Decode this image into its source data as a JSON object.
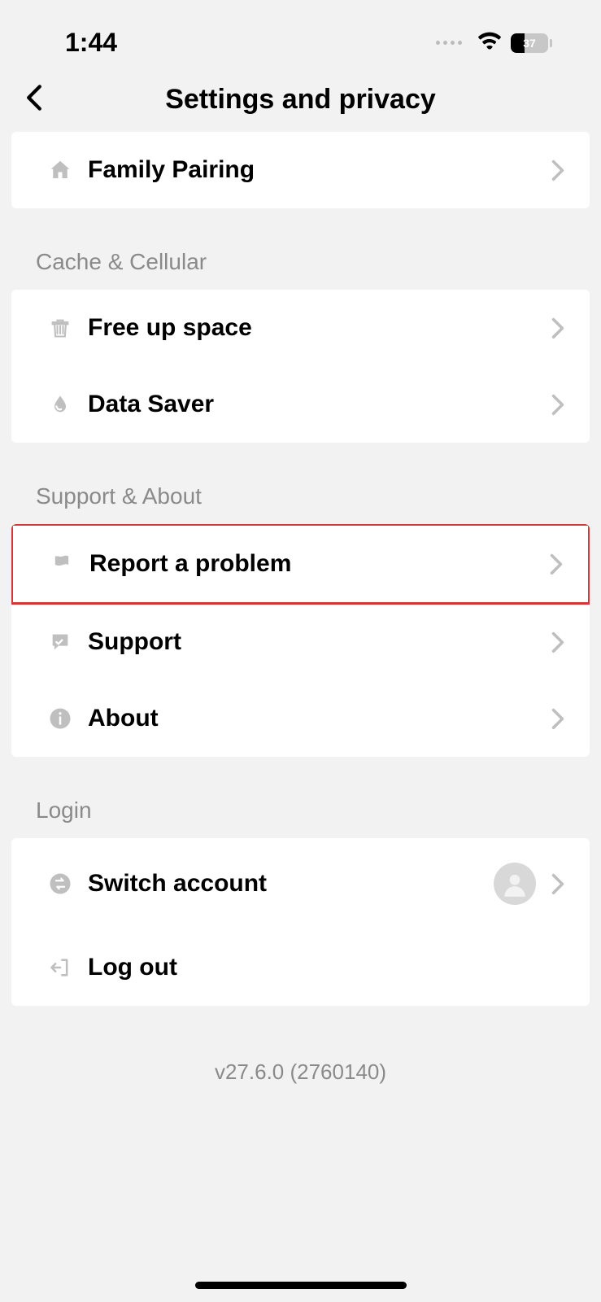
{
  "statusBar": {
    "time": "1:44",
    "battery": "37"
  },
  "header": {
    "title": "Settings and privacy"
  },
  "sections": {
    "familyPairing": {
      "label": "Family Pairing"
    },
    "cacheCellular": {
      "title": "Cache & Cellular",
      "freeUpSpace": "Free up space",
      "dataSaver": "Data Saver"
    },
    "supportAbout": {
      "title": "Support & About",
      "reportProblem": "Report a problem",
      "support": "Support",
      "about": "About"
    },
    "login": {
      "title": "Login",
      "switchAccount": "Switch account",
      "logOut": "Log out"
    }
  },
  "version": "v27.6.0 (2760140)"
}
